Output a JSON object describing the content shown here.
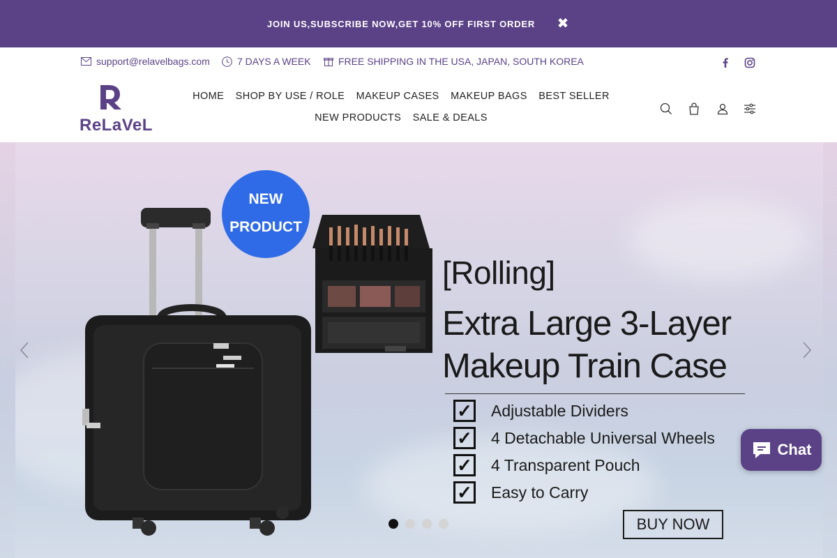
{
  "announcement": {
    "text": "JOIN US,SUBSCRIBE NOW,GET 10% OFF FIRST ORDER",
    "close_icon": "close-icon"
  },
  "infobar": {
    "email": "support@relavelbags.com",
    "hours": "7 DAYS A WEEK",
    "shipping": "FREE SHIPPING IN THE USA, JAPAN, SOUTH KOREA",
    "social": [
      "facebook-icon",
      "instagram-icon"
    ]
  },
  "header": {
    "logo_text": "ReLaVeL",
    "logo_mark": "R",
    "nav": [
      {
        "label": "HOME"
      },
      {
        "label": "SHOP BY USE / ROLE"
      },
      {
        "label": "MAKEUP CASES"
      },
      {
        "label": "MAKEUP BAGS"
      },
      {
        "label": "BEST SELLER"
      },
      {
        "label": "NEW PRODUCTS"
      },
      {
        "label": "SALE & DEALS"
      }
    ],
    "icons": [
      "search-icon",
      "bag-icon",
      "user-icon",
      "filter-icon"
    ]
  },
  "hero": {
    "badge_line1": "NEW",
    "badge_line2": "PRODUCT",
    "title_prefix": "[Rolling]",
    "title_line1": "Extra Large 3-Layer",
    "title_line2": "Makeup Train Case",
    "features": [
      "Adjustable Dividers",
      "4 Detachable Universal Wheels",
      "4 Transparent Pouch",
      "Easy to Carry"
    ],
    "check_glyph": "✓",
    "cta": "BUY NOW",
    "slides_total": 4,
    "active_slide": 1
  },
  "chat": {
    "label": "Chat"
  },
  "colors": {
    "brand": "#5b4287",
    "badge_blue": "#2f6be6",
    "text_dark": "#1a1a1a"
  }
}
